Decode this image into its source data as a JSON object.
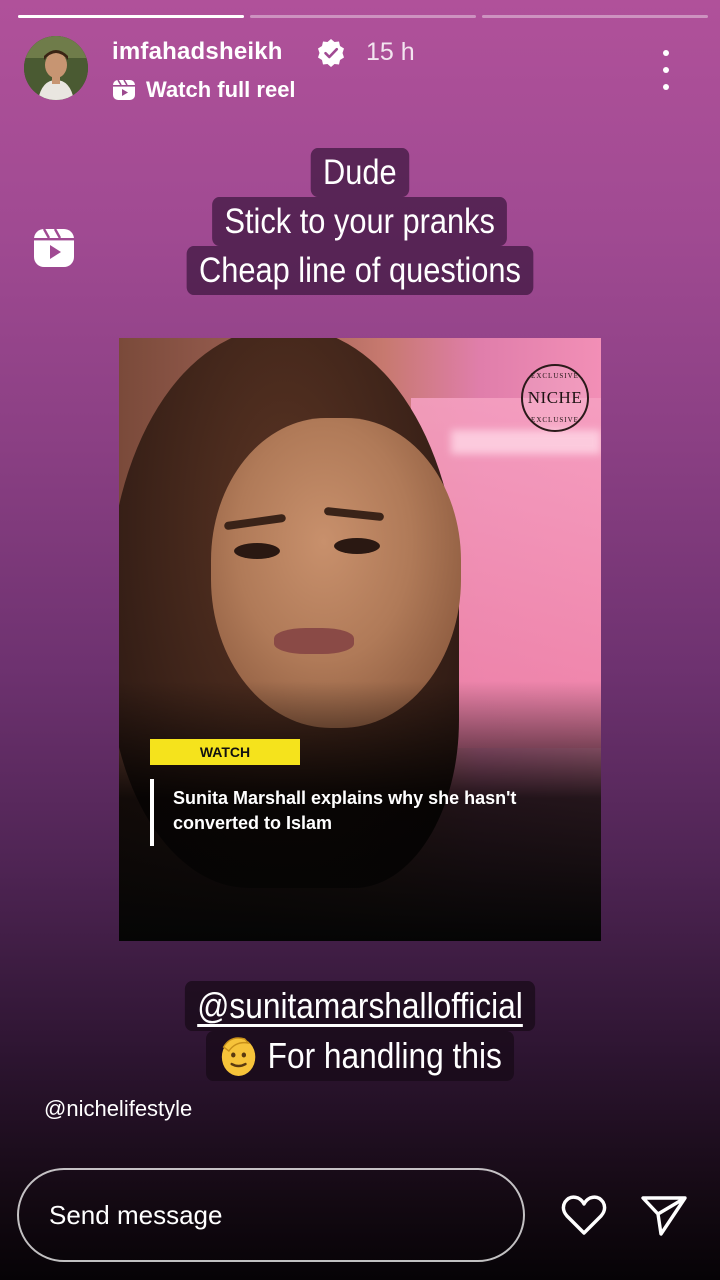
{
  "story": {
    "progress": [
      1.0,
      0.0,
      0.0
    ],
    "username": "imfahadsheikh",
    "time": "15 h",
    "watch_full_reel": "Watch full reel",
    "icons": {
      "verified": "verified-badge-icon",
      "reel": "reels-icon",
      "more": "more-options-icon",
      "like": "heart-icon",
      "share": "send-icon"
    },
    "caption_top": [
      "Dude",
      "Stick to your pranks",
      "Cheap line of questions"
    ],
    "reel": {
      "logo": "NICHE",
      "logo_ring": "EXCLUSIVE",
      "watch_label": "WATCH",
      "title": "Sunita Marshall explains why she hasn't converted to Islam",
      "accent_color": "#f5e31c"
    },
    "caption_bottom": {
      "mention": "@sunitamarshallofficial",
      "line2": "For handling this"
    },
    "handle": "@nichelifestyle",
    "send_placeholder": "Send message"
  }
}
